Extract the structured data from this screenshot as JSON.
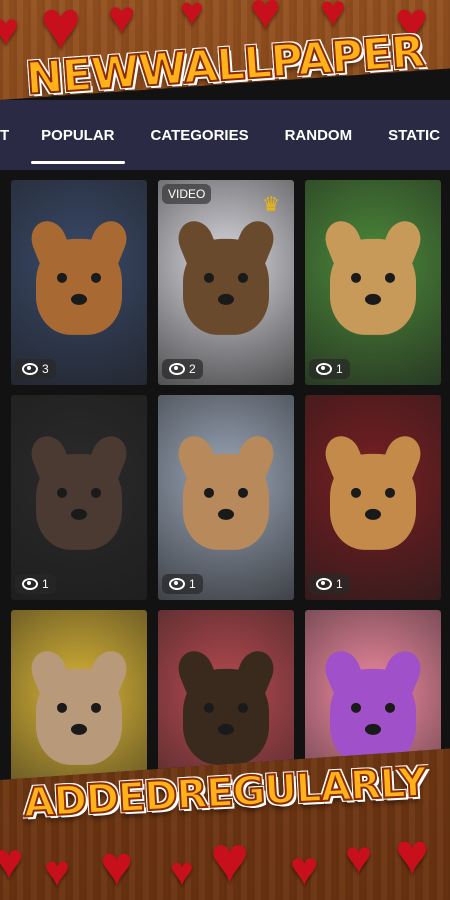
{
  "banner_top": "NEWWALLPAPER",
  "banner_bottom": "ADDEDREGULARLY",
  "tabs": [
    {
      "label": "T"
    },
    {
      "label": "POPULAR"
    },
    {
      "label": "CATEGORIES"
    },
    {
      "label": "RANDOM"
    },
    {
      "label": "STATIC"
    }
  ],
  "active_tab": "POPULAR",
  "wallpapers": [
    {
      "views": "3",
      "video": "",
      "premium": false,
      "bg": "#3a4a6a",
      "fur": "#a86a32"
    },
    {
      "views": "2",
      "video": "VIDEO",
      "premium": true,
      "bg": "#d8d8df",
      "fur": "#6a4a2c"
    },
    {
      "views": "1",
      "video": "",
      "premium": false,
      "bg": "#4c8a3a",
      "fur": "#c79a5a"
    },
    {
      "views": "1",
      "video": "",
      "premium": false,
      "bg": "#2a2a2a",
      "fur": "#4a3a32"
    },
    {
      "views": "1",
      "video": "",
      "premium": false,
      "bg": "#9aa6b8",
      "fur": "#b8895a"
    },
    {
      "views": "1",
      "video": "",
      "premium": false,
      "bg": "#7a1e22",
      "fur": "#c48a4a"
    },
    {
      "views": "",
      "video": "",
      "premium": false,
      "bg": "#d9b436",
      "fur": "#b89a7a"
    },
    {
      "views": "",
      "video": "",
      "premium": false,
      "bg": "#b84a50",
      "fur": "#3a2a1e"
    },
    {
      "views": "",
      "video": "",
      "premium": false,
      "bg": "#f08aa0",
      "fur": "#a050c8"
    }
  ],
  "colors": {
    "banner_fill": "#ffb21a",
    "tabbar": "#2a2a45",
    "heart": "#c8101c"
  }
}
